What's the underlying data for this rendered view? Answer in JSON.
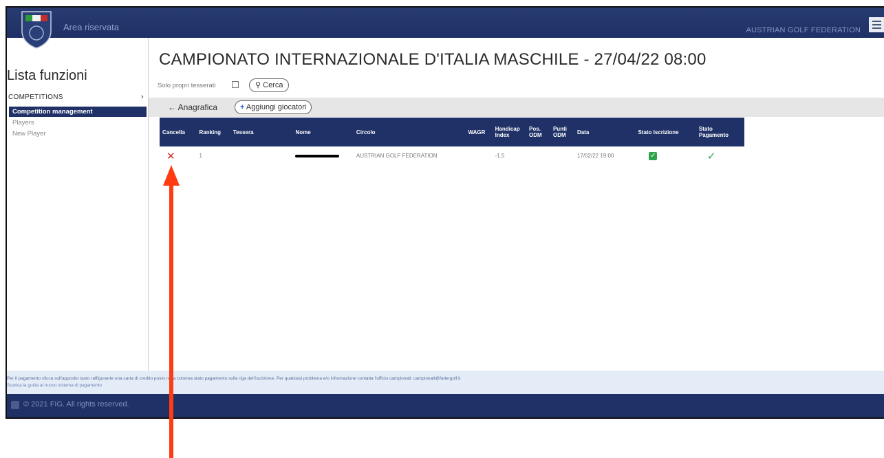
{
  "header": {
    "area_title": "Area riservata",
    "federation": "AUSTRIAN GOLF FEDERATION"
  },
  "sidebar": {
    "title": "Lista funzioni",
    "section": "COMPETITIONS",
    "items": [
      {
        "label": "Competition management",
        "active": true
      },
      {
        "label": "Players",
        "active": false
      },
      {
        "label": "New Player",
        "active": false
      }
    ]
  },
  "main": {
    "page_title": "CAMPIONATO INTERNAZIONALE D'ITALIA MASCHILE - 27/04/22 08:00",
    "filter_label": "Solo propri tesserati",
    "search_button": "Cerca",
    "back_button": "Anagrafica",
    "add_button": "Aggiungi giocatori"
  },
  "table": {
    "headers": [
      "Cancella",
      "Ranking",
      "Tessera",
      "Nome",
      "Circolo",
      "WAGR",
      "Handicap Index",
      "Pos. ODM",
      "Punti ODM",
      "Data",
      "Stato Iscrizione",
      "Stato Pagamento"
    ],
    "rows": [
      {
        "ranking": "1",
        "tessera": "",
        "circolo": "AUSTRIAN GOLF FEDERATION",
        "wagr": "",
        "handicap": "-1.5",
        "pos_odm": "",
        "punti_odm": "",
        "data": "17/02/22 19:00"
      }
    ]
  },
  "info": {
    "line1": "Per il pagamento clicca sull'apposito tasto raffigurante una carta di credito posto nella colonna stato pagamento sulla riga dell'iscrizione. Per qualsiasi problema e/o informazione contatta l'ufficio campionati: campionati@federgolf.it",
    "line2": "Scarica la guida al nuovo sistema di pagamento"
  },
  "footer": {
    "text": "© 2021 FIG. All rights reserved."
  },
  "colors": {
    "navy": "#1f3166",
    "accent_red": "#ff3b12",
    "green": "#2fa34a"
  }
}
